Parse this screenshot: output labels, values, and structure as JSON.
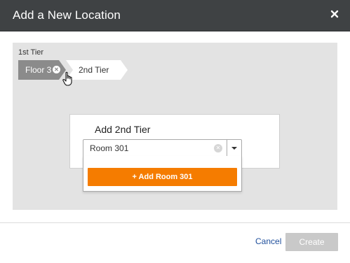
{
  "dialog": {
    "title": "Add a New Location",
    "close_icon": "close-icon"
  },
  "breadcrumb": {
    "tier_label": "1st Tier",
    "active_item": "Floor 3",
    "remove_icon": "remove-x-icon",
    "next_item": "2nd Tier"
  },
  "card": {
    "title": "Add 2nd Tier"
  },
  "select": {
    "value": "Room 301",
    "clear_icon": "clear-x-icon",
    "dropdown_icon": "chevron-down-icon",
    "option_add_label": "+ Add Room 301"
  },
  "footer": {
    "cancel_label": "Cancel",
    "create_label": "Create"
  },
  "colors": {
    "header_bg": "#3f4244",
    "body_bg": "#e3e3e3",
    "accent_orange": "#f57c00",
    "link_blue": "#1f4f9c",
    "disabled_button": "#c9c9c9"
  }
}
